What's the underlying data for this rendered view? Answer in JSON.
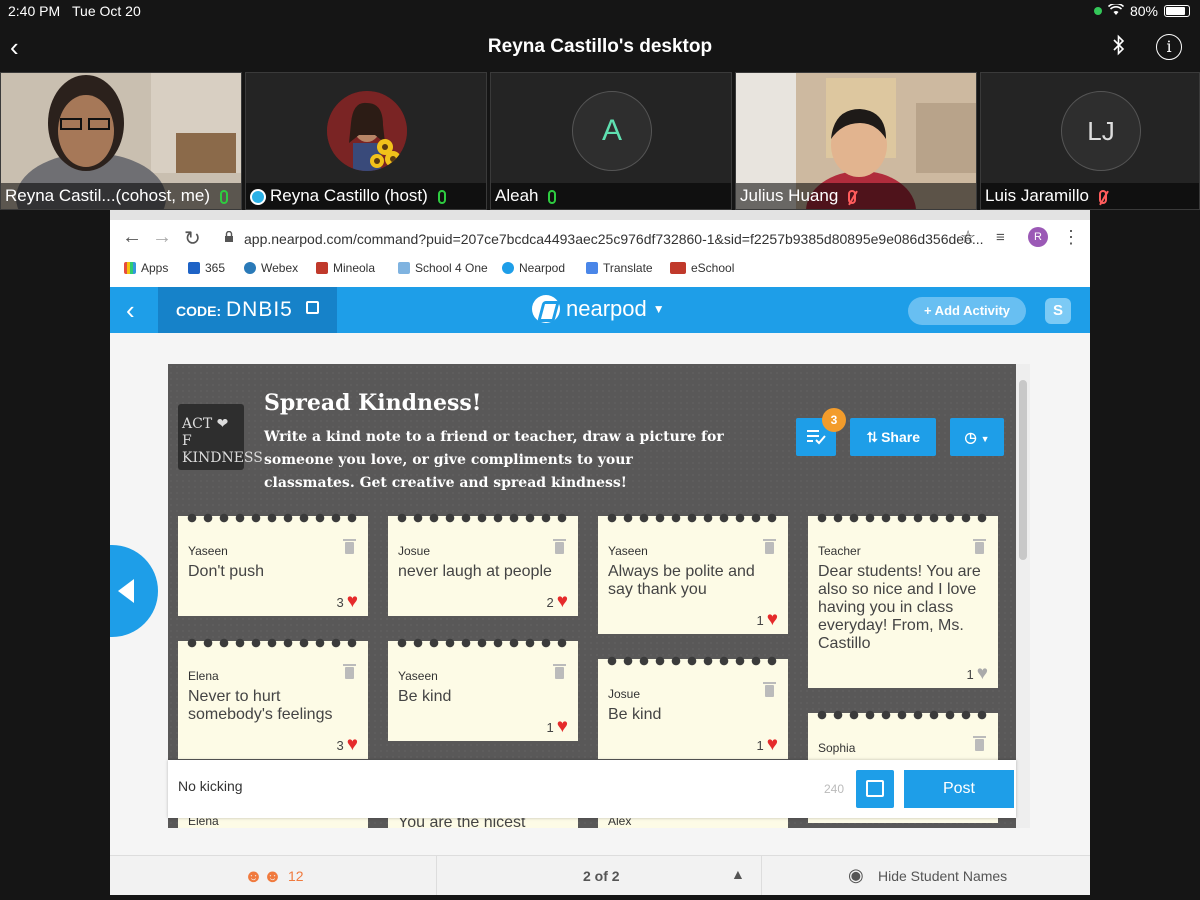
{
  "status": {
    "time": "2:40 PM",
    "date": "Tue Oct 20",
    "battery": "80%",
    "battery_level": 0.8
  },
  "zoom": {
    "title": "Reyna Castillo's desktop",
    "participants": [
      {
        "name": "Reyna Castil...(cohost, me)",
        "muted": false
      },
      {
        "name": "Reyna Castillo (host)",
        "muted": false
      },
      {
        "name": "Aleah",
        "initial": "A",
        "muted": false
      },
      {
        "name": "Julius Huang",
        "muted": true
      },
      {
        "name": "Luis Jaramillo",
        "initial": "LJ",
        "muted": true
      }
    ]
  },
  "browser": {
    "url": "app.nearpod.com/command?puid=207ce7bcdca4493aec25c976df732860-1&sid=f2257b9385d80895e9e086d356de6...",
    "profile_initial": "R",
    "bookmarks": [
      "Apps",
      "365",
      "Webex",
      "Mineola",
      "School 4 One",
      "Nearpod",
      "Translate",
      "eSchool"
    ]
  },
  "nearpod": {
    "code_label": "CODE:",
    "code_value": "DNBI5",
    "logo_text": "nearpod",
    "add_activity": "+ Add Activity",
    "s_button": "S",
    "board": {
      "thumb_line1": "ACT ❤ F",
      "thumb_line2": "KINDNESS",
      "title": "Spread Kindness!",
      "description": "Write a kind note to a friend or teacher, draw a picture for someone you love, or give compliments to your classmates. Get creative and spread kindness!",
      "badge_count": "3",
      "share_label": "Share"
    },
    "notes": [
      {
        "author": "Yaseen",
        "text": "Don't push",
        "likes": "3",
        "liked": true
      },
      {
        "author": "Josue",
        "text": "never laugh at people",
        "likes": "2",
        "liked": true
      },
      {
        "author": "Yaseen",
        "text": "Always be polite and say thank you",
        "likes": "1",
        "liked": true
      },
      {
        "author": "Teacher",
        "text": "Dear students! You are also so nice and I love having you in class everyday! From, Ms. Castillo",
        "likes": "1",
        "liked": false
      },
      {
        "author": "Elena",
        "text": "Never to hurt somebody's feelings",
        "likes": "3",
        "liked": true
      },
      {
        "author": "Yaseen",
        "text": "Be kind",
        "likes": "1",
        "liked": true
      },
      {
        "author": "Josue",
        "text": "Be kind",
        "likes": "1",
        "liked": true
      },
      {
        "author": "Sophia",
        "text": "",
        "likes": "",
        "liked": false
      },
      {
        "author": "Elena",
        "text": "",
        "likes": "",
        "liked": false
      },
      {
        "author": "",
        "text": "You are the nicest",
        "likes": "",
        "liked": false
      },
      {
        "author": "Alex",
        "text": "",
        "likes": "",
        "liked": false
      }
    ],
    "composer": {
      "value": "No kicking",
      "char_count": "240",
      "post_label": "Post"
    },
    "footer": {
      "students": "12",
      "page": "2 of 2",
      "hide_names": "Hide Student Names"
    }
  }
}
